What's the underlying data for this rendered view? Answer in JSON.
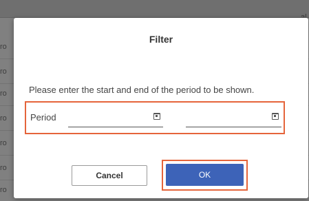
{
  "background": {
    "row_fragment_left": "ro",
    "row_fragment_right": "al l"
  },
  "dialog": {
    "title": "Filter",
    "instruction": "Please enter the start and end of the period to be shown.",
    "period_label": "Period",
    "start_date_value": "",
    "end_date_value": "",
    "calendar_icon": "calendar-icon",
    "cancel_label": "Cancel",
    "ok_label": "OK"
  },
  "colors": {
    "highlight": "#e5643a",
    "ok_button": "#3d63b8",
    "overlay": "#808080"
  }
}
